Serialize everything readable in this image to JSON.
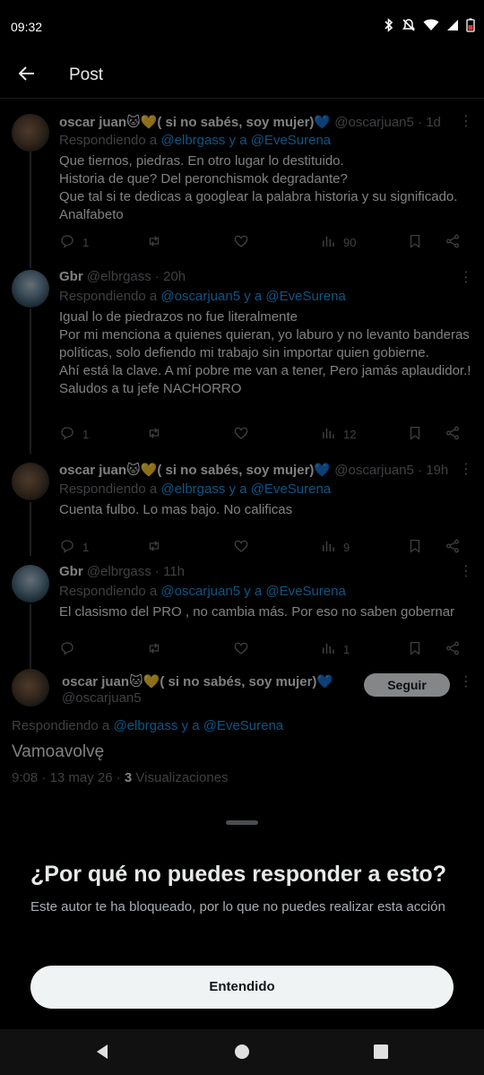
{
  "status": {
    "time": "09:32"
  },
  "header": {
    "title": "Post"
  },
  "tweets": [
    {
      "name": "oscar juan🐱💛( si no sabés, soy mujer)💙",
      "handle": "@oscarjuan5 · 1d",
      "reply_prefix": "Respondiendo a ",
      "reply_links": "@elbrgass y a @EveSurena",
      "body": "Que tiernos, piedras. En otro lugar lo destituido.\nHistoria de que? Del peronchismok degradante?\nQue tal si te dedicas a googlear la palabra historia y su significado.\nAnalfabeto",
      "replies": "1",
      "retweets": "",
      "likes": "",
      "views": "90"
    },
    {
      "name": "Gbr",
      "handle": "@elbrgass · 20h",
      "reply_prefix": "Respondiendo a ",
      "reply_links": "@oscarjuan5 y a @EveSurena",
      "body": "Igual lo de piedrazos no fue literalmente\nPor mi menciona a quienes quieran, yo laburo y no levanto banderas políticas, solo defiendo mi trabajo sin importar quien gobierne.\nAhí está la clave. A mí pobre me van a tener, Pero jamás aplaudidor.! Saludos a tu jefe NACHORRO",
      "replies": "1",
      "retweets": "",
      "likes": "",
      "views": "12"
    },
    {
      "name": "oscar juan🐱💛( si no sabés, soy mujer)💙",
      "handle": "@oscarjuan5 · 19h",
      "reply_prefix": "Respondiendo a ",
      "reply_links": "@elbrgass y a @EveSurena",
      "body": "Cuenta fulbo. Lo mas bajo. No calificas",
      "replies": "1",
      "retweets": "",
      "likes": "",
      "views": "9"
    },
    {
      "name": "Gbr",
      "handle": "@elbrgass · 11h",
      "reply_prefix": "Respondiendo a ",
      "reply_links": "@oscarjuan5 y a @EveSurena",
      "body": "El clasismo del PRO , no cambia más. Por eso no saben gobernar",
      "replies": "",
      "retweets": "",
      "likes": "",
      "views": "1"
    }
  ],
  "main_tweet": {
    "name": "oscar juan🐱💛( si no sabés, soy mujer)💙",
    "handle": "@oscarjuan5",
    "follow_label": "Seguir",
    "reply_prefix": "Respondiendo a ",
    "reply_links": "@elbrgass y a @EveSurena",
    "body": "Vamoavolvę",
    "timestamp": "9:08 · 13 may 26 · ",
    "views_count": "3",
    "views_label": " Visualizaciones"
  },
  "sheet": {
    "title": "¿Por qué no puedes responder a esto?",
    "description": "Este autor te ha bloqueado, por lo que no puedes realizar esta acción",
    "button_label": "Entendido"
  },
  "icons": {
    "back": "arrow-left-icon",
    "more": "more-vertical-icon",
    "reply": "reply-icon",
    "retweet": "retweet-icon",
    "like": "heart-icon",
    "views": "views-chart-icon",
    "bookmark": "bookmark-icon",
    "share": "share-icon"
  },
  "colors": {
    "link": "#1d9bf0",
    "muted": "#71767b",
    "background": "#000000"
  }
}
